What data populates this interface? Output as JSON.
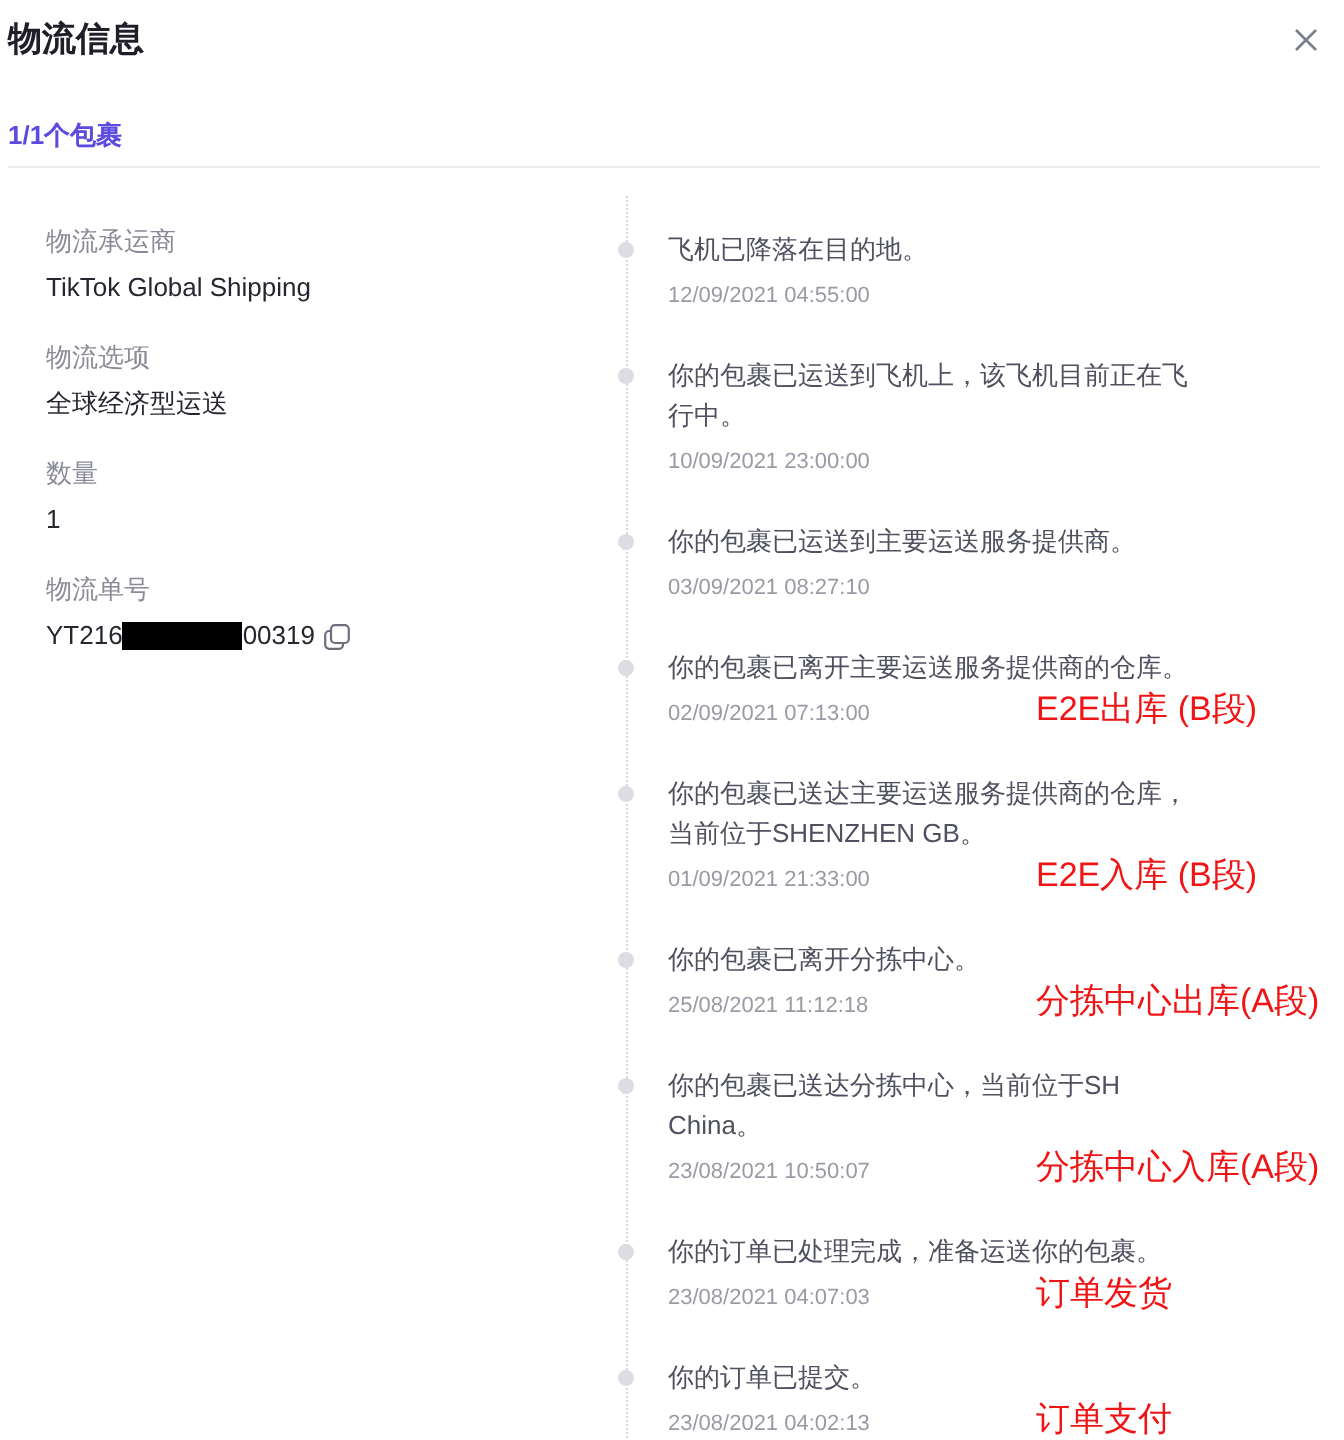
{
  "dialog": {
    "title": "物流信息"
  },
  "tabs": [
    {
      "label": "1/1个包裹",
      "selected": true
    }
  ],
  "details": [
    {
      "label": "物流承运商",
      "value": "TikTok Global Shipping"
    },
    {
      "label": "物流选项",
      "value": "全球经济型运送"
    },
    {
      "label": "数量",
      "value": "1"
    }
  ],
  "tracking": {
    "label": "物流单号",
    "prefix": "YT216",
    "suffix": "00319",
    "redacted": true
  },
  "events": [
    {
      "text": "飞机已降落在目的地。",
      "time": "12/09/2021 04:55:00"
    },
    {
      "text": "你的包裹已运送到飞机上，该飞机目前正在飞行中。",
      "time": "10/09/2021 23:00:00"
    },
    {
      "text": "你的包裹已运送到主要运送服务提供商。",
      "time": "03/09/2021 08:27:10"
    },
    {
      "text": "你的包裹已离开主要运送服务提供商的仓库。",
      "time": "02/09/2021 07:13:00",
      "annotation": "E2E出库 (B段)"
    },
    {
      "text": "你的包裹已送达主要运送服务提供商的仓库，当前位于SHENZHEN GB。",
      "time": "01/09/2021 21:33:00",
      "annotation": "E2E入库 (B段)"
    },
    {
      "text": "你的包裹已离开分拣中心。",
      "time": "25/08/2021 11:12:18",
      "annotation": "分拣中心出库(A段)"
    },
    {
      "text": "你的包裹已送达分拣中心，当前位于SH China。",
      "time": "23/08/2021 10:50:07",
      "annotation": "分拣中心入库(A段)"
    },
    {
      "text": "你的订单已处理完成，准备运送你的包裹。",
      "time": "23/08/2021 04:07:03",
      "annotation": "订单发货"
    },
    {
      "text": "你的订单已提交。",
      "time": "23/08/2021 04:02:13",
      "annotation": "订单支付"
    }
  ]
}
